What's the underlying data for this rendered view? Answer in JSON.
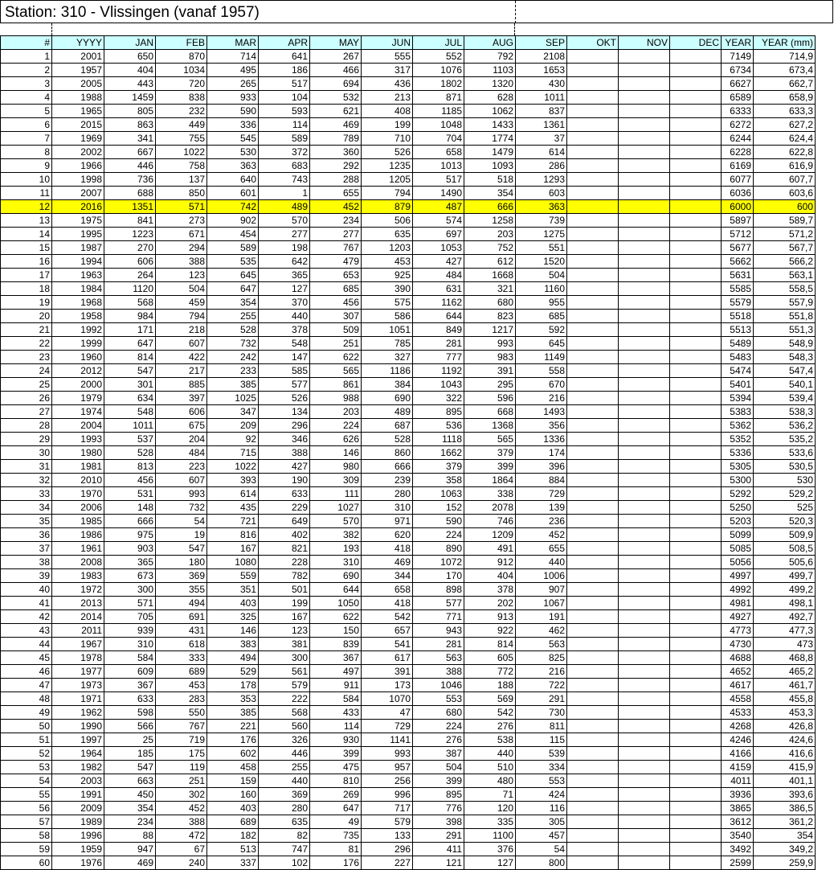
{
  "sheet": {
    "title": "Station: 310 - Vlissingen (vanaf 1957)",
    "headers": [
      "#",
      "YYYY",
      "JAN",
      "FEB",
      "MAR",
      "APR",
      "MAY",
      "JUN",
      "JUL",
      "AUG",
      "SEP",
      "OKT",
      "NOV",
      "DEC",
      "YEAR",
      "YEAR (mm)"
    ],
    "highlight_color": "#ffff00",
    "header_color": "#ccffff",
    "rows": [
      [
        "1",
        "2001",
        "650",
        "870",
        "714",
        "641",
        "267",
        "555",
        "552",
        "792",
        "2108",
        "",
        "",
        "",
        "7149",
        "714,9"
      ],
      [
        "2",
        "1957",
        "404",
        "1034",
        "495",
        "186",
        "466",
        "317",
        "1076",
        "1103",
        "1653",
        "",
        "",
        "",
        "6734",
        "673,4"
      ],
      [
        "3",
        "2005",
        "443",
        "720",
        "265",
        "517",
        "694",
        "436",
        "1802",
        "1320",
        "430",
        "",
        "",
        "",
        "6627",
        "662,7"
      ],
      [
        "4",
        "1988",
        "1459",
        "838",
        "933",
        "104",
        "532",
        "213",
        "871",
        "628",
        "1011",
        "",
        "",
        "",
        "6589",
        "658,9"
      ],
      [
        "5",
        "1965",
        "805",
        "232",
        "590",
        "593",
        "621",
        "408",
        "1185",
        "1062",
        "837",
        "",
        "",
        "",
        "6333",
        "633,3"
      ],
      [
        "6",
        "2015",
        "863",
        "449",
        "336",
        "114",
        "469",
        "199",
        "1048",
        "1433",
        "1361",
        "",
        "",
        "",
        "6272",
        "627,2"
      ],
      [
        "7",
        "1969",
        "341",
        "755",
        "545",
        "589",
        "789",
        "710",
        "704",
        "1774",
        "37",
        "",
        "",
        "",
        "6244",
        "624,4"
      ],
      [
        "8",
        "2002",
        "667",
        "1022",
        "530",
        "372",
        "360",
        "526",
        "658",
        "1479",
        "614",
        "",
        "",
        "",
        "6228",
        "622,8"
      ],
      [
        "9",
        "1966",
        "446",
        "758",
        "363",
        "683",
        "292",
        "1235",
        "1013",
        "1093",
        "286",
        "",
        "",
        "",
        "6169",
        "616,9"
      ],
      [
        "10",
        "1998",
        "736",
        "137",
        "640",
        "743",
        "288",
        "1205",
        "517",
        "518",
        "1293",
        "",
        "",
        "",
        "6077",
        "607,7"
      ],
      [
        "11",
        "2007",
        "688",
        "850",
        "601",
        "1",
        "655",
        "794",
        "1490",
        "354",
        "603",
        "",
        "",
        "",
        "6036",
        "603,6"
      ],
      [
        "12",
        "2016",
        "1351",
        "571",
        "742",
        "489",
        "452",
        "879",
        "487",
        "666",
        "363",
        "",
        "",
        "",
        "6000",
        "600"
      ],
      [
        "13",
        "1975",
        "841",
        "273",
        "902",
        "570",
        "234",
        "506",
        "574",
        "1258",
        "739",
        "",
        "",
        "",
        "5897",
        "589,7"
      ],
      [
        "14",
        "1995",
        "1223",
        "671",
        "454",
        "277",
        "277",
        "635",
        "697",
        "203",
        "1275",
        "",
        "",
        "",
        "5712",
        "571,2"
      ],
      [
        "15",
        "1987",
        "270",
        "294",
        "589",
        "198",
        "767",
        "1203",
        "1053",
        "752",
        "551",
        "",
        "",
        "",
        "5677",
        "567,7"
      ],
      [
        "16",
        "1994",
        "606",
        "388",
        "535",
        "642",
        "479",
        "453",
        "427",
        "612",
        "1520",
        "",
        "",
        "",
        "5662",
        "566,2"
      ],
      [
        "17",
        "1963",
        "264",
        "123",
        "645",
        "365",
        "653",
        "925",
        "484",
        "1668",
        "504",
        "",
        "",
        "",
        "5631",
        "563,1"
      ],
      [
        "18",
        "1984",
        "1120",
        "504",
        "647",
        "127",
        "685",
        "390",
        "631",
        "321",
        "1160",
        "",
        "",
        "",
        "5585",
        "558,5"
      ],
      [
        "19",
        "1968",
        "568",
        "459",
        "354",
        "370",
        "456",
        "575",
        "1162",
        "680",
        "955",
        "",
        "",
        "",
        "5579",
        "557,9"
      ],
      [
        "20",
        "1958",
        "984",
        "794",
        "255",
        "440",
        "307",
        "586",
        "644",
        "823",
        "685",
        "",
        "",
        "",
        "5518",
        "551,8"
      ],
      [
        "21",
        "1992",
        "171",
        "218",
        "528",
        "378",
        "509",
        "1051",
        "849",
        "1217",
        "592",
        "",
        "",
        "",
        "5513",
        "551,3"
      ],
      [
        "22",
        "1999",
        "647",
        "607",
        "732",
        "548",
        "251",
        "785",
        "281",
        "993",
        "645",
        "",
        "",
        "",
        "5489",
        "548,9"
      ],
      [
        "23",
        "1960",
        "814",
        "422",
        "242",
        "147",
        "622",
        "327",
        "777",
        "983",
        "1149",
        "",
        "",
        "",
        "5483",
        "548,3"
      ],
      [
        "24",
        "2012",
        "547",
        "217",
        "233",
        "585",
        "565",
        "1186",
        "1192",
        "391",
        "558",
        "",
        "",
        "",
        "5474",
        "547,4"
      ],
      [
        "25",
        "2000",
        "301",
        "885",
        "385",
        "577",
        "861",
        "384",
        "1043",
        "295",
        "670",
        "",
        "",
        "",
        "5401",
        "540,1"
      ],
      [
        "26",
        "1979",
        "634",
        "397",
        "1025",
        "526",
        "988",
        "690",
        "322",
        "596",
        "216",
        "",
        "",
        "",
        "5394",
        "539,4"
      ],
      [
        "27",
        "1974",
        "548",
        "606",
        "347",
        "134",
        "203",
        "489",
        "895",
        "668",
        "1493",
        "",
        "",
        "",
        "5383",
        "538,3"
      ],
      [
        "28",
        "2004",
        "1011",
        "675",
        "209",
        "296",
        "224",
        "687",
        "536",
        "1368",
        "356",
        "",
        "",
        "",
        "5362",
        "536,2"
      ],
      [
        "29",
        "1993",
        "537",
        "204",
        "92",
        "346",
        "626",
        "528",
        "1118",
        "565",
        "1336",
        "",
        "",
        "",
        "5352",
        "535,2"
      ],
      [
        "30",
        "1980",
        "528",
        "484",
        "715",
        "388",
        "146",
        "860",
        "1662",
        "379",
        "174",
        "",
        "",
        "",
        "5336",
        "533,6"
      ],
      [
        "31",
        "1981",
        "813",
        "223",
        "1022",
        "427",
        "980",
        "666",
        "379",
        "399",
        "396",
        "",
        "",
        "",
        "5305",
        "530,5"
      ],
      [
        "32",
        "2010",
        "456",
        "607",
        "393",
        "190",
        "309",
        "239",
        "358",
        "1864",
        "884",
        "",
        "",
        "",
        "5300",
        "530"
      ],
      [
        "33",
        "1970",
        "531",
        "993",
        "614",
        "633",
        "111",
        "280",
        "1063",
        "338",
        "729",
        "",
        "",
        "",
        "5292",
        "529,2"
      ],
      [
        "34",
        "2006",
        "148",
        "732",
        "435",
        "229",
        "1027",
        "310",
        "152",
        "2078",
        "139",
        "",
        "",
        "",
        "5250",
        "525"
      ],
      [
        "35",
        "1985",
        "666",
        "54",
        "721",
        "649",
        "570",
        "971",
        "590",
        "746",
        "236",
        "",
        "",
        "",
        "5203",
        "520,3"
      ],
      [
        "36",
        "1986",
        "975",
        "19",
        "816",
        "402",
        "382",
        "620",
        "224",
        "1209",
        "452",
        "",
        "",
        "",
        "5099",
        "509,9"
      ],
      [
        "37",
        "1961",
        "903",
        "547",
        "167",
        "821",
        "193",
        "418",
        "890",
        "491",
        "655",
        "",
        "",
        "",
        "5085",
        "508,5"
      ],
      [
        "38",
        "2008",
        "365",
        "180",
        "1080",
        "228",
        "310",
        "469",
        "1072",
        "912",
        "440",
        "",
        "",
        "",
        "5056",
        "505,6"
      ],
      [
        "39",
        "1983",
        "673",
        "369",
        "559",
        "782",
        "690",
        "344",
        "170",
        "404",
        "1006",
        "",
        "",
        "",
        "4997",
        "499,7"
      ],
      [
        "40",
        "1972",
        "300",
        "355",
        "351",
        "501",
        "644",
        "658",
        "898",
        "378",
        "907",
        "",
        "",
        "",
        "4992",
        "499,2"
      ],
      [
        "41",
        "2013",
        "571",
        "494",
        "403",
        "199",
        "1050",
        "418",
        "577",
        "202",
        "1067",
        "",
        "",
        "",
        "4981",
        "498,1"
      ],
      [
        "42",
        "2014",
        "705",
        "691",
        "325",
        "167",
        "622",
        "542",
        "771",
        "913",
        "191",
        "",
        "",
        "",
        "4927",
        "492,7"
      ],
      [
        "43",
        "2011",
        "939",
        "431",
        "146",
        "123",
        "150",
        "657",
        "943",
        "922",
        "462",
        "",
        "",
        "",
        "4773",
        "477,3"
      ],
      [
        "44",
        "1967",
        "310",
        "618",
        "383",
        "381",
        "839",
        "541",
        "281",
        "814",
        "563",
        "",
        "",
        "",
        "4730",
        "473"
      ],
      [
        "45",
        "1978",
        "584",
        "333",
        "494",
        "300",
        "367",
        "617",
        "563",
        "605",
        "825",
        "",
        "",
        "",
        "4688",
        "468,8"
      ],
      [
        "46",
        "1977",
        "609",
        "689",
        "529",
        "561",
        "497",
        "391",
        "388",
        "772",
        "216",
        "",
        "",
        "",
        "4652",
        "465,2"
      ],
      [
        "47",
        "1973",
        "367",
        "453",
        "178",
        "579",
        "911",
        "173",
        "1046",
        "188",
        "722",
        "",
        "",
        "",
        "4617",
        "461,7"
      ],
      [
        "48",
        "1971",
        "633",
        "283",
        "353",
        "222",
        "584",
        "1070",
        "553",
        "569",
        "291",
        "",
        "",
        "",
        "4558",
        "455,8"
      ],
      [
        "49",
        "1962",
        "598",
        "550",
        "385",
        "568",
        "433",
        "47",
        "680",
        "542",
        "730",
        "",
        "",
        "",
        "4533",
        "453,3"
      ],
      [
        "50",
        "1990",
        "566",
        "767",
        "221",
        "560",
        "114",
        "729",
        "224",
        "276",
        "811",
        "",
        "",
        "",
        "4268",
        "426,8"
      ],
      [
        "51",
        "1997",
        "25",
        "719",
        "176",
        "326",
        "930",
        "1141",
        "276",
        "538",
        "115",
        "",
        "",
        "",
        "4246",
        "424,6"
      ],
      [
        "52",
        "1964",
        "185",
        "175",
        "602",
        "446",
        "399",
        "993",
        "387",
        "440",
        "539",
        "",
        "",
        "",
        "4166",
        "416,6"
      ],
      [
        "53",
        "1982",
        "547",
        "119",
        "458",
        "255",
        "475",
        "957",
        "504",
        "510",
        "334",
        "",
        "",
        "",
        "4159",
        "415,9"
      ],
      [
        "54",
        "2003",
        "663",
        "251",
        "159",
        "440",
        "810",
        "256",
        "399",
        "480",
        "553",
        "",
        "",
        "",
        "4011",
        "401,1"
      ],
      [
        "55",
        "1991",
        "450",
        "302",
        "160",
        "369",
        "269",
        "996",
        "895",
        "71",
        "424",
        "",
        "",
        "",
        "3936",
        "393,6"
      ],
      [
        "56",
        "2009",
        "354",
        "452",
        "403",
        "280",
        "647",
        "717",
        "776",
        "120",
        "116",
        "",
        "",
        "",
        "3865",
        "386,5"
      ],
      [
        "57",
        "1989",
        "234",
        "388",
        "689",
        "635",
        "49",
        "579",
        "398",
        "335",
        "305",
        "",
        "",
        "",
        "3612",
        "361,2"
      ],
      [
        "58",
        "1996",
        "88",
        "472",
        "182",
        "82",
        "735",
        "133",
        "291",
        "1100",
        "457",
        "",
        "",
        "",
        "3540",
        "354"
      ],
      [
        "59",
        "1959",
        "947",
        "67",
        "513",
        "747",
        "81",
        "296",
        "411",
        "376",
        "54",
        "",
        "",
        "",
        "3492",
        "349,2"
      ],
      [
        "60",
        "1976",
        "469",
        "240",
        "337",
        "102",
        "176",
        "227",
        "121",
        "127",
        "800",
        "",
        "",
        "",
        "2599",
        "259,9"
      ]
    ]
  }
}
